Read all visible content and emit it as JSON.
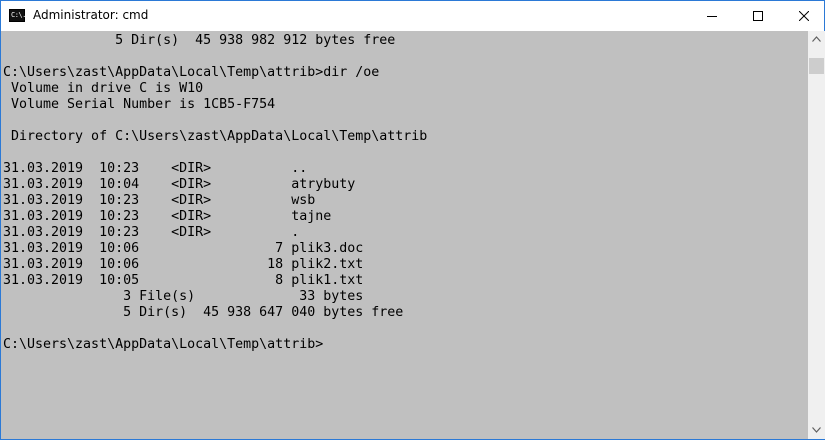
{
  "window": {
    "title": "Administrator: cmd",
    "app_icon_text": "C:\\."
  },
  "console": {
    "lines": [
      "              5 Dir(s)  45 938 982 912 bytes free",
      "",
      "C:\\Users\\zast\\AppData\\Local\\Temp\\attrib>dir /oe",
      " Volume in drive C is W10",
      " Volume Serial Number is 1CB5-F754",
      "",
      " Directory of C:\\Users\\zast\\AppData\\Local\\Temp\\attrib",
      "",
      "31.03.2019  10:23    <DIR>          ..",
      "31.03.2019  10:04    <DIR>          atrybuty",
      "31.03.2019  10:23    <DIR>          wsb",
      "31.03.2019  10:23    <DIR>          tajne",
      "31.03.2019  10:23    <DIR>          .",
      "31.03.2019  10:06                 7 plik3.doc",
      "31.03.2019  10:06                18 plik2.txt",
      "31.03.2019  10:05                 8 plik1.txt",
      "               3 File(s)             33 bytes",
      "               5 Dir(s)  45 938 647 040 bytes free",
      "",
      "C:\\Users\\zast\\AppData\\Local\\Temp\\attrib>"
    ]
  },
  "icons": {
    "minimize": "minimize-icon",
    "maximize": "maximize-icon",
    "close": "close-icon",
    "scroll_up": "chevron-up-icon",
    "scroll_down": "chevron-down-icon"
  },
  "colors": {
    "console_bg": "#c0c0c0",
    "text": "#000000",
    "border": "#2b79d6"
  }
}
